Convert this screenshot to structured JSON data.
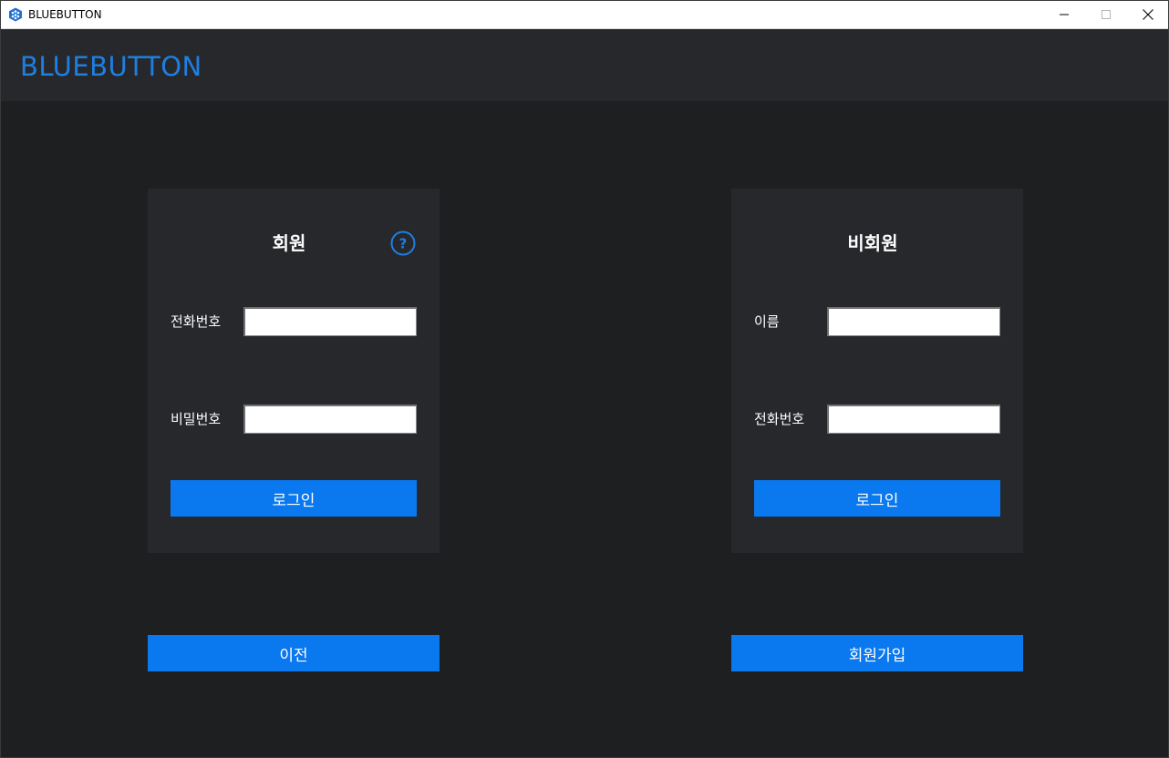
{
  "window": {
    "title": "BLUEBUTTON",
    "controls": [
      "minimize-icon",
      "maximize-icon",
      "close-icon"
    ]
  },
  "header": {
    "brand": "BLUEBUTTON"
  },
  "member_panel": {
    "title": "회원",
    "help_icon": "question-icon",
    "fields": [
      {
        "label": "전화번호",
        "value": "",
        "placeholder": ""
      },
      {
        "label": "비밀번호",
        "value": "",
        "placeholder": ""
      }
    ],
    "login_label": "로그인"
  },
  "guest_panel": {
    "title": "비회원",
    "fields": [
      {
        "label": "이름",
        "value": "",
        "placeholder": ""
      },
      {
        "label": "전화번호",
        "value": "",
        "placeholder": ""
      }
    ],
    "login_label": "로그인"
  },
  "footer": {
    "prev_label": "이전",
    "signup_label": "회원가입"
  },
  "colors": {
    "accent": "#0a78ee",
    "brand_text": "#1e7fe3",
    "background": "#1e1f21",
    "panel": "#27282c"
  }
}
